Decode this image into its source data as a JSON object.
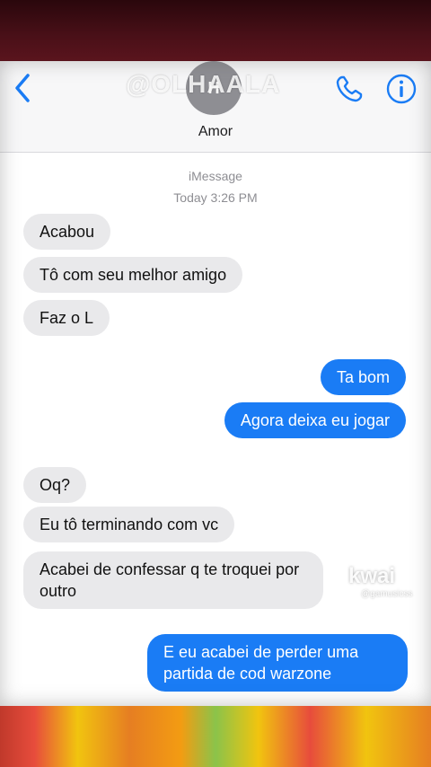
{
  "watermark": {
    "text": "@OLHAALA"
  },
  "header": {
    "back_icon": "chevron-left-icon",
    "avatar_initials": "H",
    "contact_name": "Amor",
    "call_icon": "phone-icon",
    "info_icon": "info-icon",
    "accent_color": "#1a7cf5"
  },
  "thread": {
    "service": "iMessage",
    "timestamp": "Today 3:26 PM"
  },
  "messages": [
    {
      "from": "them",
      "text": "Acabou"
    },
    {
      "from": "them",
      "text": "Tô com seu melhor amigo"
    },
    {
      "from": "them",
      "text": "Faz o L"
    },
    {
      "from": "me",
      "text": "Ta bom"
    },
    {
      "from": "me",
      "text": "Agora deixa eu jogar"
    },
    {
      "from": "them",
      "text": "Oq?"
    },
    {
      "from": "them",
      "text": "Eu tô terminando com vc"
    },
    {
      "from": "them",
      "text": "Acabei de confessar q te troquei por outro"
    },
    {
      "from": "me",
      "text": "E eu acabei de perder uma partida de cod warzone"
    }
  ],
  "kwai": {
    "logo": "kwai",
    "user": "@gamusicss"
  }
}
